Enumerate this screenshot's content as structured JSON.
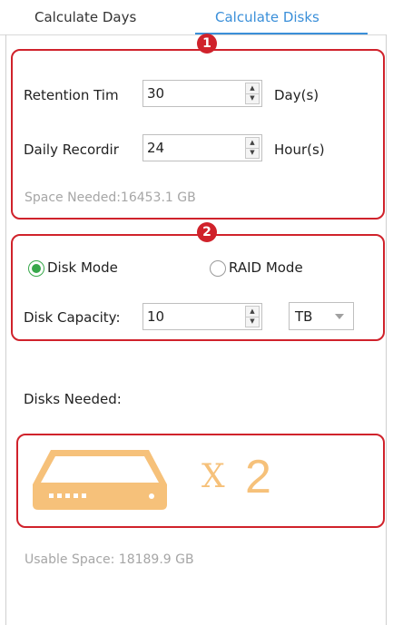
{
  "tabs": [
    {
      "label": "Calculate Days",
      "active": false
    },
    {
      "label": "Calculate Disks",
      "active": true
    }
  ],
  "badges": [
    "1",
    "2"
  ],
  "retention": {
    "label": "Retention Tim",
    "value": "30",
    "unit": "Day(s)"
  },
  "daily": {
    "label": "Daily Recordir",
    "value": "24",
    "unit": "Hour(s)"
  },
  "space_needed": "Space Needed:16453.1 GB",
  "mode": {
    "options": [
      "Disk Mode",
      "RAID Mode"
    ],
    "selected": "Disk Mode"
  },
  "disk_capacity": {
    "label": "Disk Capacity:",
    "value": "10",
    "unit": "TB"
  },
  "disks_needed": {
    "label": "Disks Needed:",
    "multiplier": "X",
    "count": "2"
  },
  "usable_space": "Usable Space: 18189.9 GB",
  "colors": {
    "accent": "#3a8fd9",
    "highlight": "#d0222b",
    "disk": "#f6c17a",
    "radio": "#37a84a"
  }
}
